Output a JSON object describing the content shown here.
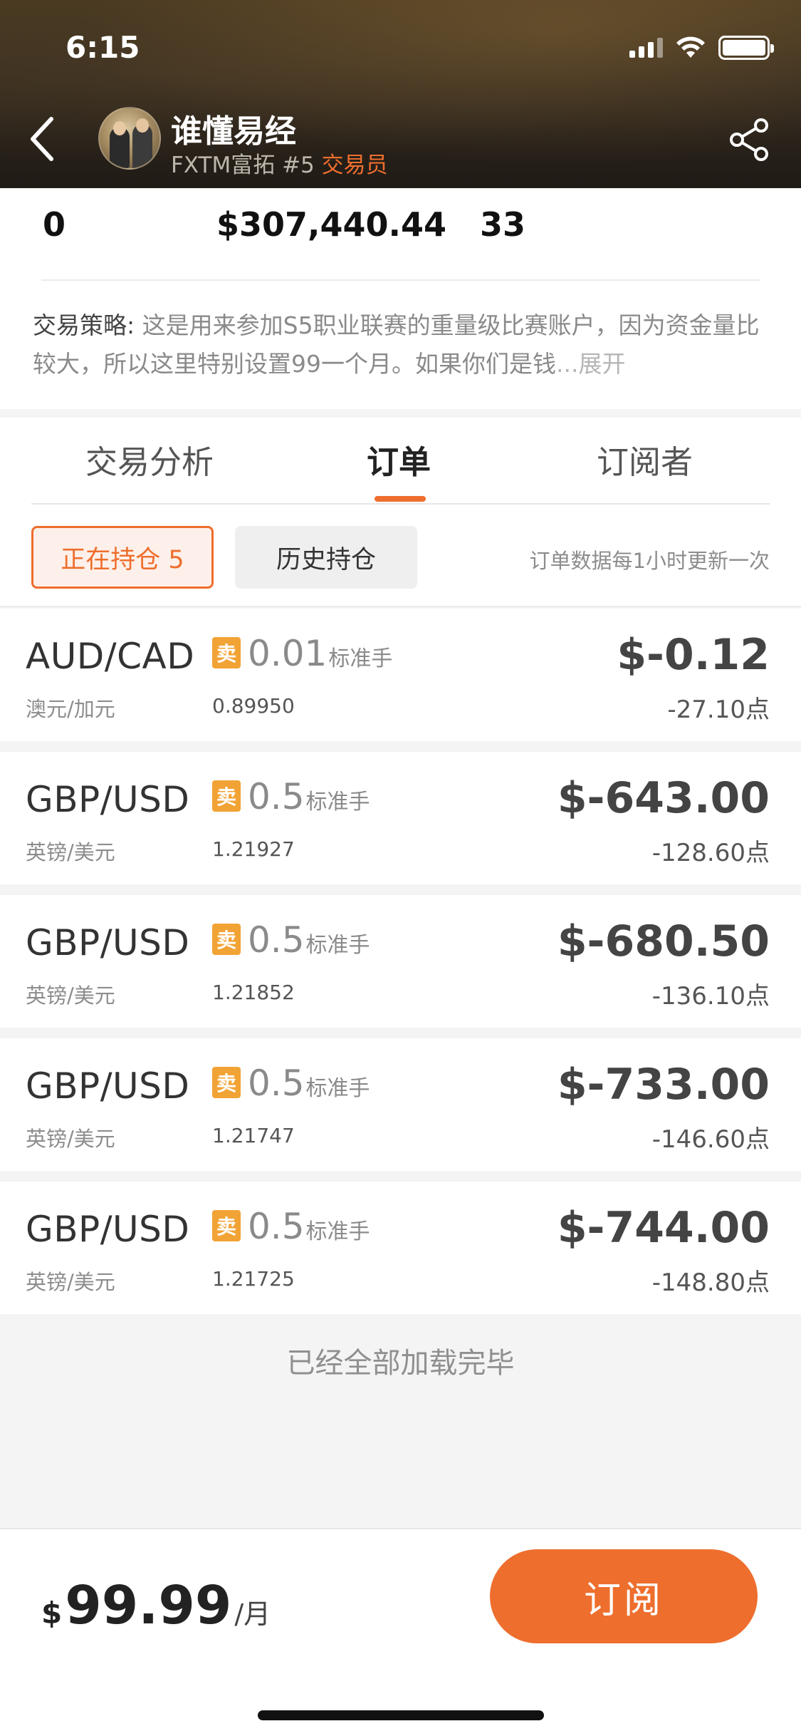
{
  "status_bar": {
    "time": "6:15"
  },
  "header": {
    "name": "谁懂易经",
    "broker": "FXTM富拓",
    "rank": "#5",
    "role": "交易员"
  },
  "stats": {
    "stat1": "0",
    "stat2": "$307,440.44",
    "stat3": "33"
  },
  "strategy": {
    "label": "交易策略:",
    "text": "这是用来参加S5职业联赛的重量级比赛账户，因为资金量比较大，所以这里特别设置99一个月。如果你们是钱",
    "ellipsis": "...",
    "more": "展开"
  },
  "tabs": [
    {
      "label": "交易分析",
      "active": false
    },
    {
      "label": "订单",
      "active": true
    },
    {
      "label": "订阅者",
      "active": false
    }
  ],
  "filters": {
    "current": "正在持仓 5",
    "history": "历史持仓",
    "note": "订单数据每1小时更新一次"
  },
  "orders": [
    {
      "pair": "AUD/CAD",
      "pair_cn": "澳元/加元",
      "side": "卖",
      "lots": "0.01",
      "unit": "标准手",
      "price": "0.89950",
      "pnl": "$-0.12",
      "pips": "-27.10点"
    },
    {
      "pair": "GBP/USD",
      "pair_cn": "英镑/美元",
      "side": "卖",
      "lots": "0.5",
      "unit": "标准手",
      "price": "1.21927",
      "pnl": "$-643.00",
      "pips": "-128.60点"
    },
    {
      "pair": "GBP/USD",
      "pair_cn": "英镑/美元",
      "side": "卖",
      "lots": "0.5",
      "unit": "标准手",
      "price": "1.21852",
      "pnl": "$-680.50",
      "pips": "-136.10点"
    },
    {
      "pair": "GBP/USD",
      "pair_cn": "英镑/美元",
      "side": "卖",
      "lots": "0.5",
      "unit": "标准手",
      "price": "1.21747",
      "pnl": "$-733.00",
      "pips": "-146.60点"
    },
    {
      "pair": "GBP/USD",
      "pair_cn": "英镑/美元",
      "side": "卖",
      "lots": "0.5",
      "unit": "标准手",
      "price": "1.21725",
      "pnl": "$-744.00",
      "pips": "-148.80点"
    }
  ],
  "loaded_text": "已经全部加载完毕",
  "subscription": {
    "currency": "$",
    "amount": "99.99",
    "period": "/月",
    "button": "订阅"
  },
  "colors": {
    "accent": "#ee6e2d",
    "sell_badge": "#f2a335"
  },
  "icons": {
    "back": "chevron-left-icon",
    "share": "share-icon",
    "signal": "cellular-signal-icon",
    "wifi": "wifi-icon",
    "battery": "battery-icon"
  }
}
